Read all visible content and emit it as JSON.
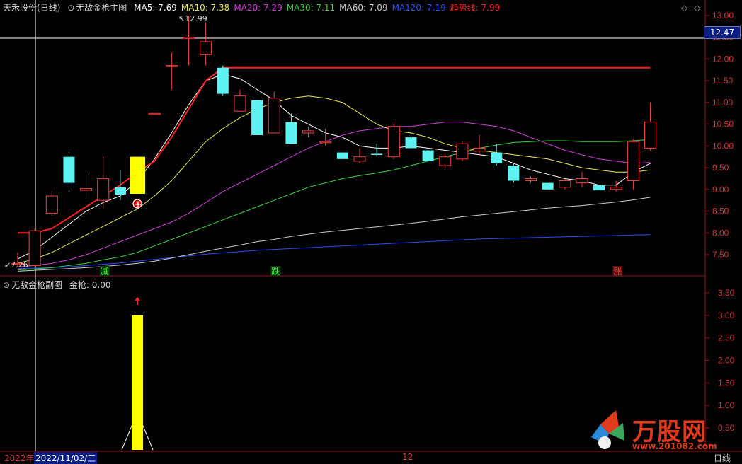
{
  "main_panel": {
    "header": {
      "stock_name": "天禾股份",
      "period": "(日线)",
      "indicator_name": "无敌金枪主图",
      "ma": [
        {
          "label": "MA5: 7.69",
          "color": "#ffffff"
        },
        {
          "label": "MA10: 7.38",
          "color": "#e8e85a"
        },
        {
          "label": "MA20: 7.29",
          "color": "#d040d8"
        },
        {
          "label": "MA30: 7.11",
          "color": "#40d040"
        },
        {
          "label": "MA60: 7.09",
          "color": "#cccccc"
        },
        {
          "label": "MA120: 7.19",
          "color": "#2a4cff"
        },
        {
          "label": "趋势线: 7.99",
          "color": "#ff2020"
        }
      ]
    },
    "current_price": "12.47",
    "high_marker": "12.99",
    "low_marker": "7.26",
    "signals": [
      {
        "text": "减",
        "color": "#40ff40",
        "index": 5
      },
      {
        "text": "跌",
        "color": "#40ff40",
        "index": 15
      },
      {
        "text": "涨",
        "color": "#ff4040",
        "index": 35
      }
    ]
  },
  "sub_panel": {
    "header": {
      "indicator_name": "无敌金枪副图",
      "value_label": "金枪: 0.00"
    },
    "y_ticks": [
      "3.50",
      "3.00",
      "2.50",
      "2.00",
      "1.50",
      "1.00",
      "0.50"
    ]
  },
  "y_axis_ticks": [
    "13.00",
    "12.50",
    "12.00",
    "11.50",
    "11.00",
    "10.50",
    "10.00",
    "9.50",
    "9.00",
    "8.50",
    "8.00",
    "7.50"
  ],
  "x_axis": {
    "year_label": "2022年",
    "cursor_date": "2022/11/02/三",
    "month_label": "12",
    "period_label": "日线"
  },
  "watermark": {
    "title": "万股网",
    "url": "www.201082.com"
  },
  "chart_data": {
    "type": "candlestick",
    "ylim": [
      7.2,
      13.2
    ],
    "candles": [
      {
        "o": 7.28,
        "c": 7.3,
        "h": 7.55,
        "l": 7.22
      },
      {
        "o": 7.25,
        "c": 8.05,
        "h": 8.1,
        "l": 7.2
      },
      {
        "o": 8.45,
        "c": 8.85,
        "h": 8.95,
        "l": 8.4
      },
      {
        "o": 9.75,
        "c": 9.15,
        "h": 9.85,
        "l": 8.95
      },
      {
        "o": 8.98,
        "c": 9.02,
        "h": 9.35,
        "l": 8.8
      },
      {
        "o": 8.75,
        "c": 9.25,
        "h": 9.75,
        "l": 8.55
      },
      {
        "o": 9.05,
        "c": 8.88,
        "h": 9.45,
        "l": 8.75
      },
      {
        "o": 9.75,
        "c": 8.9,
        "h": 9.75,
        "l": 8.9
      },
      {
        "o": 10.75,
        "c": 10.75,
        "h": 10.75,
        "l": 10.75
      },
      {
        "o": 11.85,
        "c": 11.85,
        "h": 12.15,
        "l": 11.3
      },
      {
        "o": 12.5,
        "c": 12.5,
        "h": 12.99,
        "l": 11.85
      },
      {
        "o": 12.1,
        "c": 12.4,
        "h": 12.85,
        "l": 11.85
      },
      {
        "o": 11.8,
        "c": 11.2,
        "h": 11.85,
        "l": 11.15
      },
      {
        "o": 10.8,
        "c": 11.15,
        "h": 11.3,
        "l": 10.8
      },
      {
        "o": 11.05,
        "c": 10.25,
        "h": 11.05,
        "l": 10.25
      },
      {
        "o": 10.3,
        "c": 11.1,
        "h": 11.25,
        "l": 10.3
      },
      {
        "o": 10.55,
        "c": 10.05,
        "h": 10.75,
        "l": 10.05
      },
      {
        "o": 10.3,
        "c": 10.35,
        "h": 10.45,
        "l": 10.2
      },
      {
        "o": 10.1,
        "c": 10.1,
        "h": 10.4,
        "l": 10.0
      },
      {
        "o": 9.85,
        "c": 9.7,
        "h": 9.85,
        "l": 9.7
      },
      {
        "o": 9.65,
        "c": 9.75,
        "h": 9.95,
        "l": 9.6
      },
      {
        "o": 9.82,
        "c": 9.8,
        "h": 10.05,
        "l": 9.75
      },
      {
        "o": 9.75,
        "c": 10.45,
        "h": 10.55,
        "l": 9.7
      },
      {
        "o": 10.2,
        "c": 9.95,
        "h": 10.25,
        "l": 9.95
      },
      {
        "o": 9.9,
        "c": 9.65,
        "h": 9.9,
        "l": 9.65
      },
      {
        "o": 9.55,
        "c": 9.75,
        "h": 9.8,
        "l": 9.5
      },
      {
        "o": 9.7,
        "c": 10.05,
        "h": 10.1,
        "l": 9.65
      },
      {
        "o": 9.88,
        "c": 9.95,
        "h": 10.25,
        "l": 9.8
      },
      {
        "o": 9.85,
        "c": 9.6,
        "h": 10.05,
        "l": 9.55
      },
      {
        "o": 9.55,
        "c": 9.2,
        "h": 9.6,
        "l": 9.15
      },
      {
        "o": 9.2,
        "c": 9.25,
        "h": 9.3,
        "l": 9.15
      },
      {
        "o": 9.15,
        "c": 9.0,
        "h": 9.15,
        "l": 9.0
      },
      {
        "o": 9.05,
        "c": 9.2,
        "h": 9.25,
        "l": 9.0
      },
      {
        "o": 9.15,
        "c": 9.25,
        "h": 9.4,
        "l": 9.05
      },
      {
        "o": 9.1,
        "c": 8.98,
        "h": 9.1,
        "l": 8.98
      },
      {
        "o": 9.0,
        "c": 9.05,
        "h": 9.2,
        "l": 8.95
      },
      {
        "o": 9.2,
        "c": 10.1,
        "h": 10.15,
        "l": 9.0
      },
      {
        "o": 9.95,
        "c": 10.55,
        "h": 11.0,
        "l": 9.9
      }
    ],
    "lines": {
      "trend": [
        8.0,
        8.0,
        8.1,
        8.35,
        8.6,
        8.85,
        9.1,
        9.4,
        9.65,
        10.2,
        10.85,
        11.5,
        11.8,
        11.8,
        11.8,
        11.8,
        11.8,
        11.8,
        11.8,
        11.8,
        11.8,
        11.8,
        11.8,
        11.8,
        11.8,
        11.8,
        11.8,
        11.8,
        11.8,
        11.8,
        11.8,
        11.8,
        11.8,
        11.8,
        11.8,
        11.8,
        11.8,
        11.8
      ],
      "ma5": [
        7.4,
        7.6,
        7.9,
        8.2,
        8.5,
        8.7,
        8.85,
        9.2,
        9.7,
        10.3,
        10.95,
        11.5,
        11.65,
        11.55,
        11.3,
        11.05,
        10.7,
        10.5,
        10.3,
        10.2,
        10.0,
        9.95,
        9.95,
        10.0,
        9.95,
        9.9,
        9.85,
        9.8,
        9.75,
        9.6,
        9.45,
        9.35,
        9.25,
        9.2,
        9.1,
        9.1,
        9.4,
        9.6
      ],
      "ma10": [
        7.3,
        7.4,
        7.55,
        7.75,
        7.95,
        8.15,
        8.35,
        8.55,
        8.85,
        9.2,
        9.65,
        10.1,
        10.4,
        10.65,
        10.85,
        11.0,
        11.1,
        11.15,
        11.1,
        11.0,
        10.75,
        10.5,
        10.35,
        10.3,
        10.2,
        10.05,
        9.95,
        9.9,
        9.85,
        9.8,
        9.75,
        9.7,
        9.6,
        9.5,
        9.45,
        9.4,
        9.4,
        9.45
      ],
      "ma20": [
        7.22,
        7.25,
        7.3,
        7.38,
        7.5,
        7.65,
        7.8,
        7.95,
        8.1,
        8.25,
        8.45,
        8.7,
        8.95,
        9.15,
        9.35,
        9.55,
        9.75,
        9.95,
        10.1,
        10.25,
        10.35,
        10.4,
        10.45,
        10.45,
        10.5,
        10.55,
        10.55,
        10.5,
        10.45,
        10.35,
        10.2,
        10.05,
        9.9,
        9.8,
        9.7,
        9.65,
        9.6,
        9.62
      ],
      "ma30": [
        7.15,
        7.17,
        7.2,
        7.25,
        7.3,
        7.38,
        7.45,
        7.55,
        7.7,
        7.85,
        8.0,
        8.15,
        8.3,
        8.45,
        8.6,
        8.75,
        8.9,
        9.05,
        9.15,
        9.25,
        9.32,
        9.38,
        9.45,
        9.55,
        9.65,
        9.75,
        9.85,
        9.95,
        10.02,
        10.08,
        10.1,
        10.12,
        10.12,
        10.1,
        10.1,
        10.1,
        10.12,
        10.15
      ],
      "ma60": [
        7.12,
        7.14,
        7.16,
        7.18,
        7.2,
        7.23,
        7.26,
        7.3,
        7.35,
        7.42,
        7.5,
        7.58,
        7.65,
        7.72,
        7.8,
        7.85,
        7.92,
        7.97,
        8.02,
        8.06,
        8.1,
        8.14,
        8.18,
        8.22,
        8.27,
        8.32,
        8.37,
        8.41,
        8.45,
        8.49,
        8.53,
        8.57,
        8.6,
        8.63,
        8.67,
        8.71,
        8.76,
        8.82
      ],
      "ma120": [
        7.18,
        7.19,
        7.2,
        7.22,
        7.25,
        7.28,
        7.31,
        7.35,
        7.39,
        7.43,
        7.47,
        7.51,
        7.54,
        7.57,
        7.6,
        7.62,
        7.64,
        7.66,
        7.68,
        7.7,
        7.72,
        7.74,
        7.76,
        7.78,
        7.8,
        7.82,
        7.84,
        7.86,
        7.87,
        7.88,
        7.89,
        7.9,
        7.91,
        7.92,
        7.93,
        7.94,
        7.95,
        7.96
      ]
    },
    "signal_bar": {
      "index": 7,
      "top": 9.75,
      "bottom": 8.9
    },
    "sub_bar": {
      "index": 7,
      "value": 3.0
    }
  }
}
